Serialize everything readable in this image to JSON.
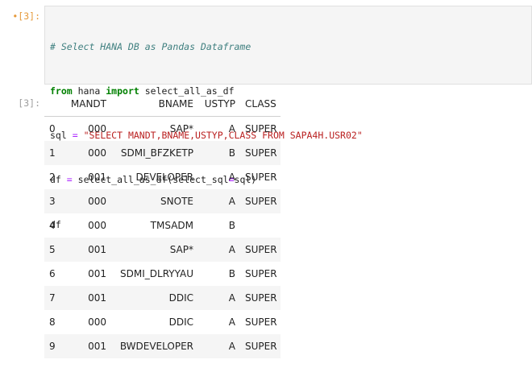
{
  "input_prompt": "[3]:",
  "input_marker": "•",
  "code": {
    "comment": "# Select HANA DB as Pandas Dataframe",
    "line2": {
      "kw1": "from",
      "mod": " hana ",
      "kw2": "import",
      "rest": " select_all_as_df"
    },
    "line3": {
      "lhs": "sql ",
      "op": "=",
      "str": " \"SELECT MANDT,BNAME,USTYP,CLASS FROM SAPA4H.USR02\""
    },
    "line4": {
      "lhs": "df ",
      "op": "=",
      "rest": " select_all_as_df(select_sql",
      "op2": "=",
      "rest2": "sql)"
    },
    "line5": "df"
  },
  "output_prompt": "[3]:",
  "table": {
    "columns": [
      "MANDT",
      "BNAME",
      "USTYP",
      "CLASS"
    ],
    "rows": [
      {
        "index": "0",
        "MANDT": "000",
        "BNAME": "SAP*",
        "USTYP": "A",
        "CLASS": "SUPER"
      },
      {
        "index": "1",
        "MANDT": "000",
        "BNAME": "SDMI_BFZKETP",
        "USTYP": "B",
        "CLASS": "SUPER"
      },
      {
        "index": "2",
        "MANDT": "001",
        "BNAME": "DEVELOPER",
        "USTYP": "A",
        "CLASS": "SUPER"
      },
      {
        "index": "3",
        "MANDT": "000",
        "BNAME": "SNOTE",
        "USTYP": "A",
        "CLASS": "SUPER"
      },
      {
        "index": "4",
        "MANDT": "000",
        "BNAME": "TMSADM",
        "USTYP": "B",
        "CLASS": ""
      },
      {
        "index": "5",
        "MANDT": "001",
        "BNAME": "SAP*",
        "USTYP": "A",
        "CLASS": "SUPER"
      },
      {
        "index": "6",
        "MANDT": "001",
        "BNAME": "SDMI_DLRYYAU",
        "USTYP": "B",
        "CLASS": "SUPER"
      },
      {
        "index": "7",
        "MANDT": "001",
        "BNAME": "DDIC",
        "USTYP": "A",
        "CLASS": "SUPER"
      },
      {
        "index": "8",
        "MANDT": "000",
        "BNAME": "DDIC",
        "USTYP": "A",
        "CLASS": "SUPER"
      },
      {
        "index": "9",
        "MANDT": "001",
        "BNAME": "BWDEVELOPER",
        "USTYP": "A",
        "CLASS": "SUPER"
      }
    ]
  },
  "colors": {
    "prompt_active": "#e69a3b",
    "comment": "#408080",
    "keyword": "#008000",
    "string": "#ba2121",
    "stripe": "#f5f5f5"
  }
}
